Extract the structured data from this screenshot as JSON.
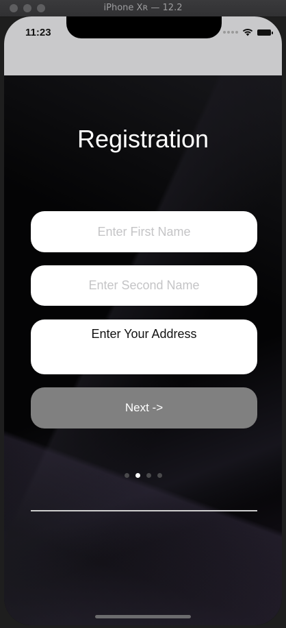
{
  "window": {
    "title": "iPhone Xʀ — 12.2"
  },
  "status_bar": {
    "time": "11:23",
    "icons": [
      "signal-dots-icon",
      "wifi-icon",
      "battery-icon"
    ]
  },
  "screen": {
    "title": "Registration",
    "fields": {
      "first_name": {
        "placeholder": "Enter First Name",
        "value": ""
      },
      "second_name": {
        "placeholder": "Enter Second Name",
        "value": ""
      },
      "address": {
        "value": "Enter Your Address"
      }
    },
    "next_button_label": "Next ->",
    "page_indicator": {
      "count": 4,
      "current": 2
    }
  },
  "colors": {
    "status_bar_bg": "#c9c9cb",
    "background": "#040405",
    "field_bg": "#ffffff",
    "placeholder": "#c4c4c6",
    "button_bg": "#808080",
    "button_text": "#ffffff",
    "divider": "#cfcfcf"
  }
}
